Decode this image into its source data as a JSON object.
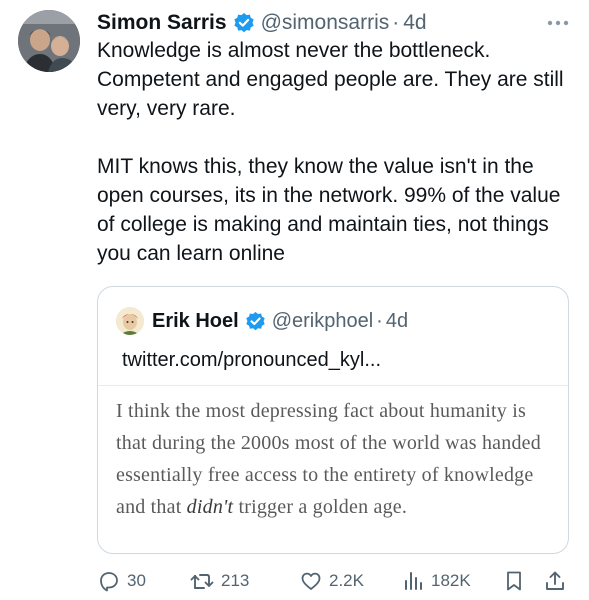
{
  "tweet": {
    "author": {
      "name": "Simon Sarris",
      "handle": "@simonsarris",
      "separator": "·",
      "time": "4d"
    },
    "paragraphs": [
      "Knowledge is almost never the bottleneck. Competent and engaged people are. They are still very, very rare.",
      "MIT knows this, they know the value isn't in the open courses, its in the network. 99% of the value of college is making and maintain ties, not things you can learn online"
    ],
    "quote": {
      "author": {
        "name": "Erik Hoel",
        "handle": "@erikphoel",
        "separator": "·",
        "time": "4d"
      },
      "link": "twitter.com/pronounced_kyl...",
      "quoted_text_before": "I think the most depressing fact about humanity is that during the 2000s most of the world was handed essentially free access to the entirety of knowledge and that ",
      "quoted_text_emphasis": "didn't",
      "quoted_text_after": " trigger a golden age."
    },
    "actions": {
      "replies": "30",
      "retweets": "213",
      "likes": "2.2K",
      "views": "182K"
    },
    "colors": {
      "verified": "#1d9bf0",
      "text": "#0f1419",
      "secondary": "#536471",
      "border": "#cfd9de"
    },
    "icons": [
      "verified-badge-icon",
      "more-icon",
      "reply-icon",
      "retweet-icon",
      "like-icon",
      "views-icon",
      "bookmark-icon",
      "share-icon"
    ]
  }
}
